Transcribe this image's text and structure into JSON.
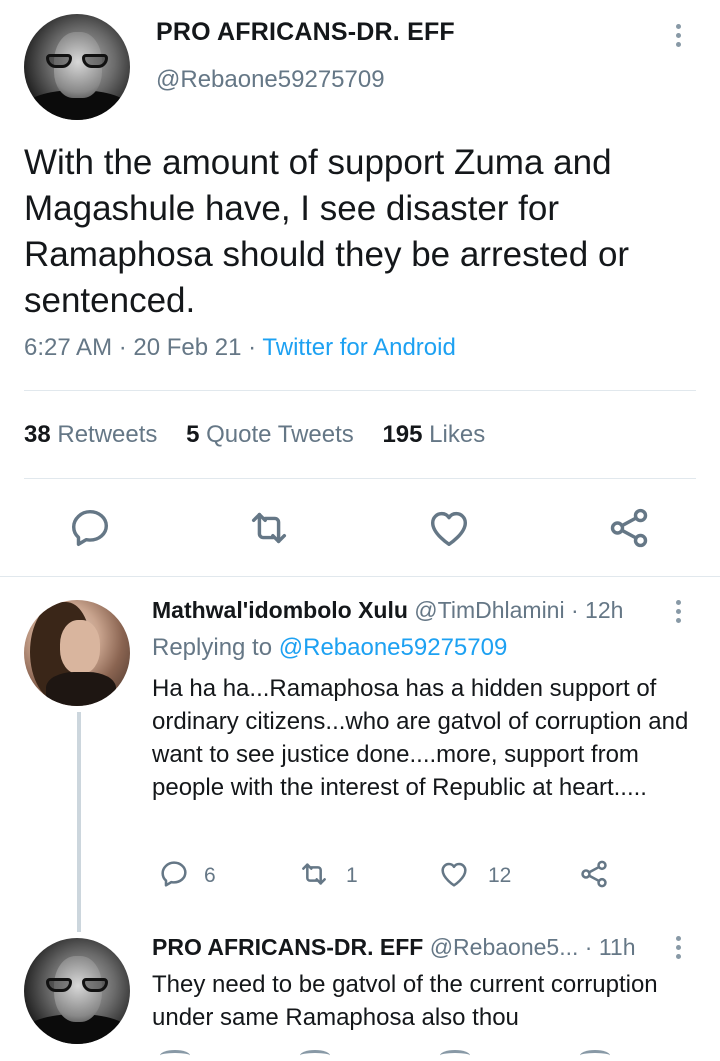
{
  "colors": {
    "accent": "#1da1f2",
    "secondary_text": "#657786",
    "icon": "#657786"
  },
  "main_tweet": {
    "author_name": "PRO AFRICANS-DR. EFF",
    "author_handle": "@Rebaone59275709",
    "text": "With the amount of support Zuma and Magashule have, I see disaster for Ramaphosa should they be arrested or sentenced.",
    "time": "6:27 AM",
    "date": "20 Feb 21",
    "sep": "·",
    "source": "Twitter for Android",
    "retweets_count": "38",
    "retweets_label": "Retweets",
    "quotes_count": "5",
    "quotes_label": "Quote Tweets",
    "likes_count": "195",
    "likes_label": "Likes",
    "icons": [
      "reply-icon",
      "retweet-icon",
      "like-icon",
      "share-icon"
    ]
  },
  "replies": [
    {
      "author_name": "Mathwal'idombolo Xulu",
      "author_handle": "@TimDhlamini",
      "time": "· 12h",
      "replying_prefix": "Replying to",
      "replying_to": "@Rebaone59275709",
      "text": "Ha ha ha...Ramaphosa has a hidden support of ordinary citizens...who are gatvol of corruption and want to see justice done....more, support from people with the interest of Republic at heart.....",
      "reply_count": "6",
      "retweet_count": "1",
      "like_count": "12"
    },
    {
      "author_name": "PRO AFRICANS-DR. EFF",
      "author_handle": "@Rebaone5...",
      "time": "· 11h",
      "text": "They need to be gatvol of the current corruption under same Ramaphosa also thou"
    }
  ]
}
